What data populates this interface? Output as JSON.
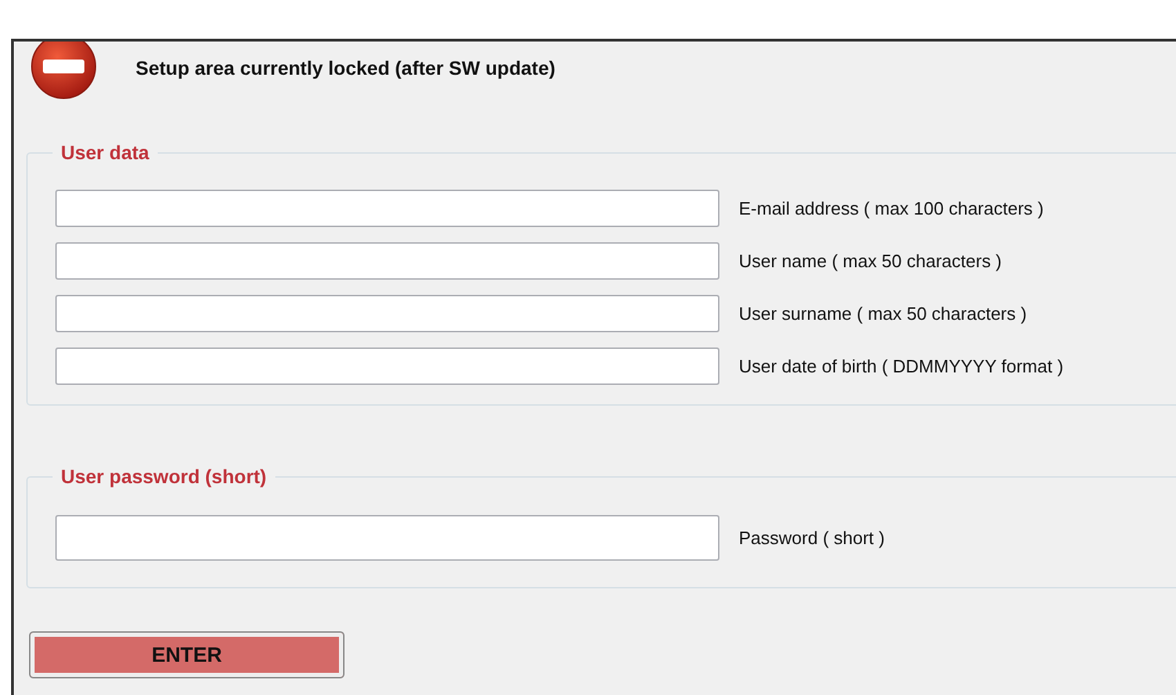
{
  "header": {
    "message": "Setup area currently locked (after SW update)"
  },
  "groups": [
    {
      "title": "User data",
      "fields": [
        {
          "label": "E-mail address ( max 100 characters )"
        },
        {
          "label": "User name ( max 50 characters )"
        },
        {
          "label": "User surname ( max 50 characters )"
        },
        {
          "label": "User date of birth ( DDMMYYYY format )"
        }
      ]
    },
    {
      "title": "User password (short)",
      "fields": [
        {
          "label": "Password ( short )"
        }
      ]
    }
  ],
  "buttons": [
    "ENTER"
  ]
}
